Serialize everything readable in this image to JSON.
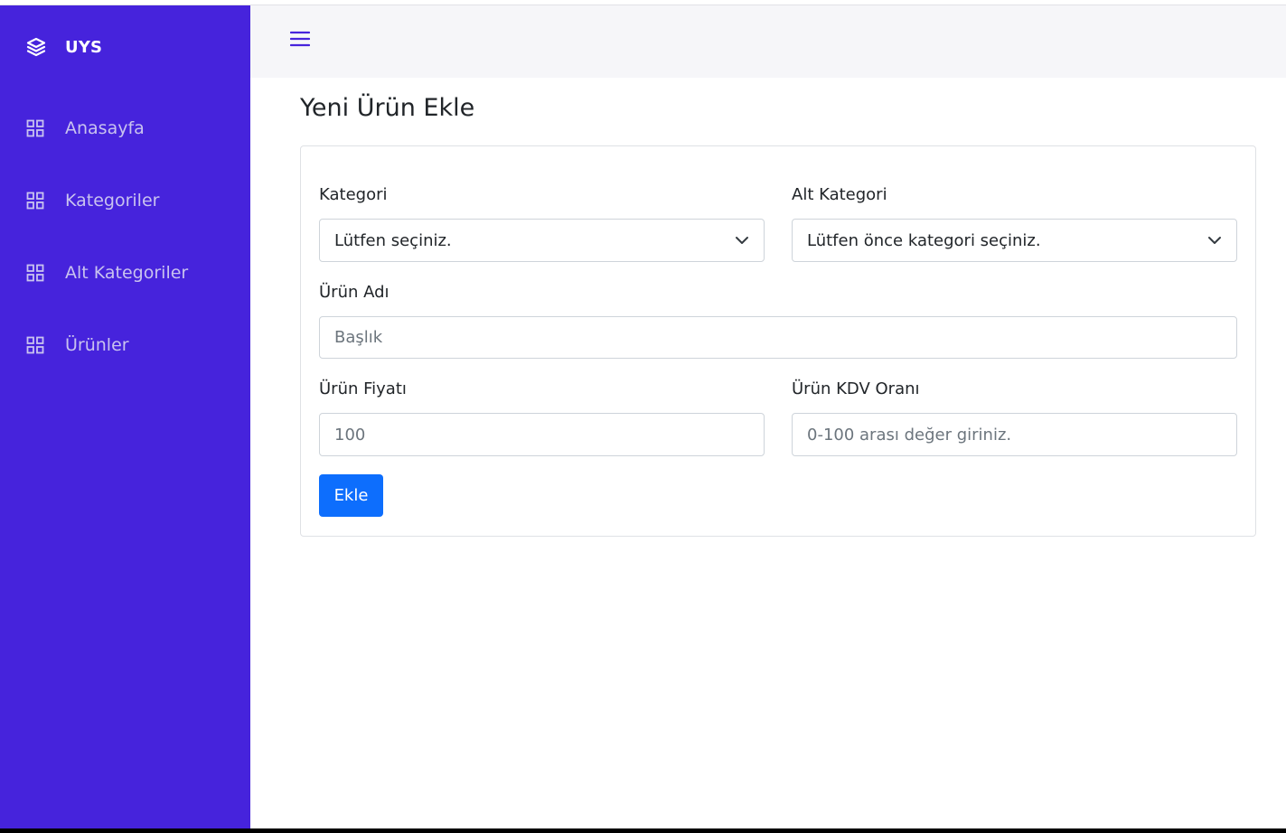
{
  "brand": {
    "name": "UYS",
    "icon": "layers-icon"
  },
  "sidebar": {
    "items": [
      {
        "label": "Anasayfa",
        "icon": "grid-icon"
      },
      {
        "label": "Kategoriler",
        "icon": "grid-icon"
      },
      {
        "label": "Alt Kategoriler",
        "icon": "grid-icon"
      },
      {
        "label": "Ürünler",
        "icon": "grid-icon"
      }
    ]
  },
  "header": {
    "menu_icon": "hamburger-icon"
  },
  "main": {
    "title": "Yeni Ürün Ekle",
    "form": {
      "category": {
        "label": "Kategori",
        "selected": "Lütfen seçiniz."
      },
      "subcategory": {
        "label": "Alt Kategori",
        "selected": "Lütfen önce kategori seçiniz."
      },
      "name": {
        "label": "Ürün Adı",
        "value": "",
        "placeholder": "Başlık"
      },
      "price": {
        "label": "Ürün Fiyatı",
        "value": "",
        "placeholder": "100"
      },
      "vat": {
        "label": "Ürün KDV Oranı",
        "value": "",
        "placeholder": "0-100 arası değer giriniz."
      },
      "submit_label": "Ekle"
    }
  },
  "colors": {
    "sidebar_bg": "#4623dc",
    "sidebar_text": "#c9c3ef",
    "header_bg": "#f6f6f9",
    "primary_button": "#0d6efd",
    "menu_icon": "#4623dc"
  }
}
